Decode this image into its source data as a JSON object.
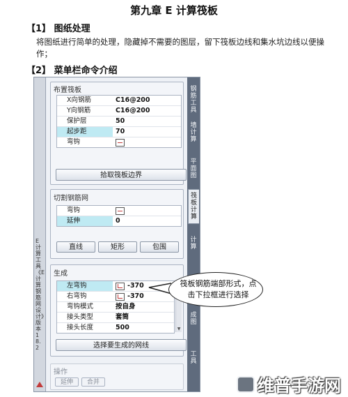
{
  "title": "第九章 E 计算筏板",
  "section1": {
    "heading": "【1】 图纸处理",
    "text": "将图纸进行简单的处理，隐藏掉不需要的图层，留下筏板边线和集水坑边线以便操作；"
  },
  "section2": {
    "heading": "【2】 菜单栏命令介绍"
  },
  "panel": {
    "side_title": "E计算工具 《E计算钢筋网设计》 版本18.2",
    "right_tabs": [
      "钢筋工具",
      "墙计算",
      "平面图",
      "筏板计算",
      "计算",
      "成图",
      "工具"
    ],
    "layout_group": {
      "title": "布置筏板",
      "rows": [
        {
          "name": "X向钢筋",
          "value": "C16@200",
          "hl": false
        },
        {
          "name": "Y向钢筋",
          "value": "C16@200",
          "hl": false
        },
        {
          "name": "保护层",
          "value": "50",
          "hl": false
        },
        {
          "name": "起步距",
          "value": "70",
          "hl": true
        },
        {
          "name": "弯钩",
          "value": "",
          "hl": false
        }
      ],
      "button": "拾取筏板边界"
    },
    "cut_group": {
      "title": "切割钢筋网",
      "rows": [
        {
          "name": "弯钩",
          "value": "",
          "hl": false
        },
        {
          "name": "延伸",
          "value": "0",
          "hl": true
        }
      ],
      "buttons": [
        "直线",
        "矩形",
        "包围"
      ]
    },
    "gen_group": {
      "title": "生成",
      "rows": [
        {
          "name": "左弯钩",
          "value": "-370",
          "hl": true
        },
        {
          "name": "右弯钩",
          "value": "-370",
          "hl": false
        },
        {
          "name": "弯钩模式",
          "value": "按自身",
          "hl": false
        },
        {
          "name": "接头类型",
          "value": "套筒",
          "hl": false
        },
        {
          "name": "接头长度",
          "value": "500",
          "hl": false
        }
      ],
      "button": "选择要生成的网线"
    },
    "ops_group": {
      "title": "操作",
      "buttons": [
        "延伸",
        "合并"
      ]
    }
  },
  "callout": {
    "text": "筏板钢筋端部形式，点击下拉框进行选择"
  },
  "watermark": {
    "text": "维普手游网"
  },
  "colors": {
    "highlight": "#bfeaf3",
    "tab_strip": "#5f6b7d",
    "hook_red": "#c23b3b"
  }
}
